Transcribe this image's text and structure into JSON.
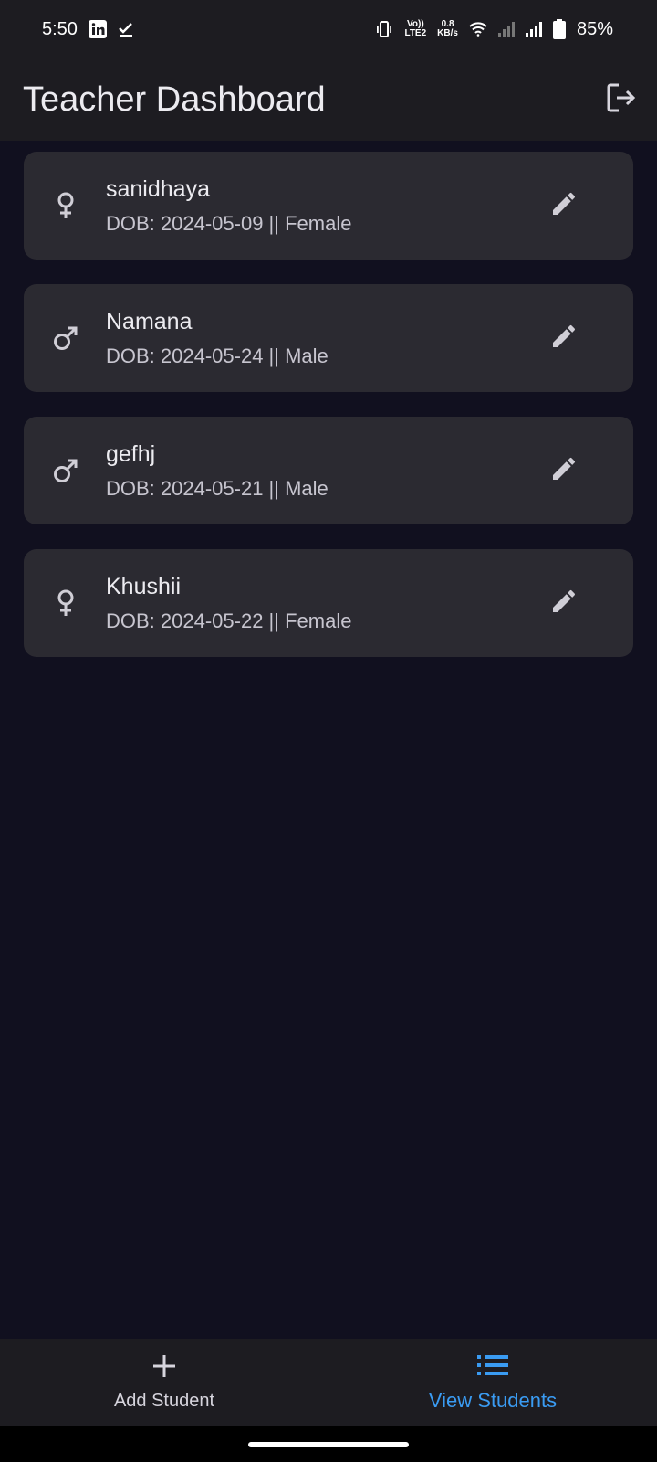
{
  "status_bar": {
    "time": "5:50",
    "network_top": "Vo))",
    "network_bottom": "LTE2",
    "speed_value": "0.8",
    "speed_unit": "KB/s",
    "battery": "85%",
    "icons": [
      "linkedin-icon",
      "download-done-icon",
      "vibrate-icon",
      "wifi-icon",
      "signal-icon",
      "battery-icon"
    ]
  },
  "app_bar": {
    "title": "Teacher Dashboard",
    "action_icon": "logout-icon"
  },
  "students": [
    {
      "name": "sanidhaya",
      "subtitle": "DOB: 2024-05-09 || Female",
      "gender_icon": "female-icon"
    },
    {
      "name": "Namana",
      "subtitle": "DOB: 2024-05-24 || Male",
      "gender_icon": "male-icon"
    },
    {
      "name": "gefhj",
      "subtitle": "DOB: 2024-05-21 || Male",
      "gender_icon": "male-icon"
    },
    {
      "name": "Khushii",
      "subtitle": "DOB: 2024-05-22 || Female",
      "gender_icon": "female-icon"
    }
  ],
  "bottom_nav": {
    "add_label": "Add Student",
    "view_label": "View Students",
    "active": "View Students"
  },
  "colors": {
    "background": "#11101f",
    "bar": "#1d1c21",
    "card": "#2b2a31",
    "accent": "#3a9bf2"
  }
}
